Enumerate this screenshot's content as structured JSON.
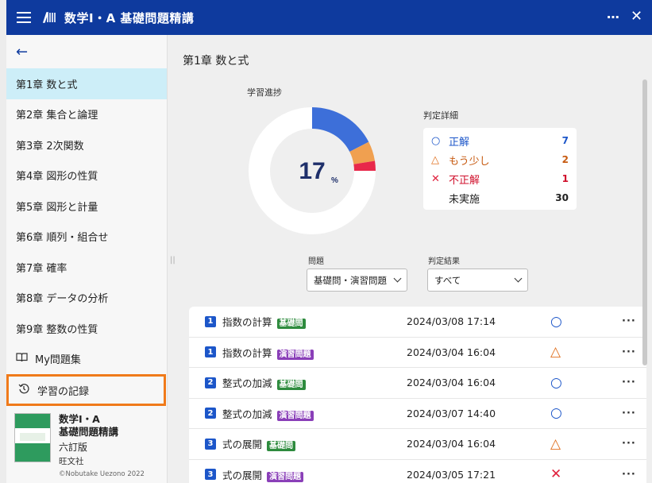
{
  "header": {
    "title": "数学Ⅰ・A 基礎問題精講",
    "more": "⋯",
    "close": "✕"
  },
  "sidebar": {
    "back": "←",
    "items": [
      {
        "label": "第1章 数と式",
        "active": true
      },
      {
        "label": "第2章 集合と論理"
      },
      {
        "label": "第3章 2次関数"
      },
      {
        "label": "第4章 図形の性質"
      },
      {
        "label": "第5章 図形と計量"
      },
      {
        "label": "第6章 順列・組合せ"
      },
      {
        "label": "第7章 確率"
      },
      {
        "label": "第8章 データの分析"
      },
      {
        "label": "第9章 整数の性質"
      }
    ],
    "my_problems": "My問題集",
    "history": "学習の記録",
    "book": {
      "title_line1": "数学Ⅰ・A",
      "title_line2": "基礎問題精講",
      "edition": "六訂版",
      "publisher": "旺文社",
      "copyright": "©Nobutake Uezono 2022"
    }
  },
  "main": {
    "chapter_title": "第1章 数と式",
    "progress_label": "学習進捗",
    "progress_percent": "17",
    "percent_sign": "%",
    "details_label": "判定詳細",
    "details": [
      {
        "mark": "○",
        "label": "正解",
        "count": "7",
        "color": "#1c56c9"
      },
      {
        "mark": "△",
        "label": "もう少し",
        "count": "2",
        "color": "#e07020"
      },
      {
        "mark": "✕",
        "label": "不正解",
        "count": "1",
        "color": "#e0203c"
      },
      {
        "mark": "",
        "label": "未実施",
        "count": "30",
        "color": "#222222"
      }
    ],
    "filter_problem_label": "問題",
    "filter_problem_value": "基礎問・演習問題",
    "filter_result_label": "判定結果",
    "filter_result_value": "すべて",
    "rows": [
      {
        "num": "1",
        "title": "指数の計算",
        "tag": "基礎問",
        "tag_type": "basic",
        "date": "2024/03/08 17:14",
        "mark": "○",
        "mark_color": "#1c56c9"
      },
      {
        "num": "1",
        "title": "指数の計算",
        "tag": "演習問題",
        "tag_type": "practice",
        "date": "2024/03/04 16:04",
        "mark": "△",
        "mark_color": "#e07020"
      },
      {
        "num": "2",
        "title": "整式の加減",
        "tag": "基礎問",
        "tag_type": "basic",
        "date": "2024/03/04 16:04",
        "mark": "○",
        "mark_color": "#1c56c9"
      },
      {
        "num": "2",
        "title": "整式の加減",
        "tag": "演習問題",
        "tag_type": "practice",
        "date": "2024/03/07 14:40",
        "mark": "○",
        "mark_color": "#1c56c9"
      },
      {
        "num": "3",
        "title": "式の展開",
        "tag": "基礎問",
        "tag_type": "basic",
        "date": "2024/03/04 16:04",
        "mark": "△",
        "mark_color": "#e07020"
      },
      {
        "num": "3",
        "title": "式の展開",
        "tag": "演習問題",
        "tag_type": "practice",
        "date": "2024/03/05 17:21",
        "mark": "✕",
        "mark_color": "#e0203c"
      }
    ]
  },
  "chart_data": {
    "type": "pie",
    "categories": [
      "正解",
      "もう少し",
      "不正解",
      "未実施"
    ],
    "values": [
      7,
      2,
      1,
      30
    ],
    "colors": [
      "#3d6fd9",
      "#f0a050",
      "#e8284a",
      "#ffffff"
    ]
  }
}
